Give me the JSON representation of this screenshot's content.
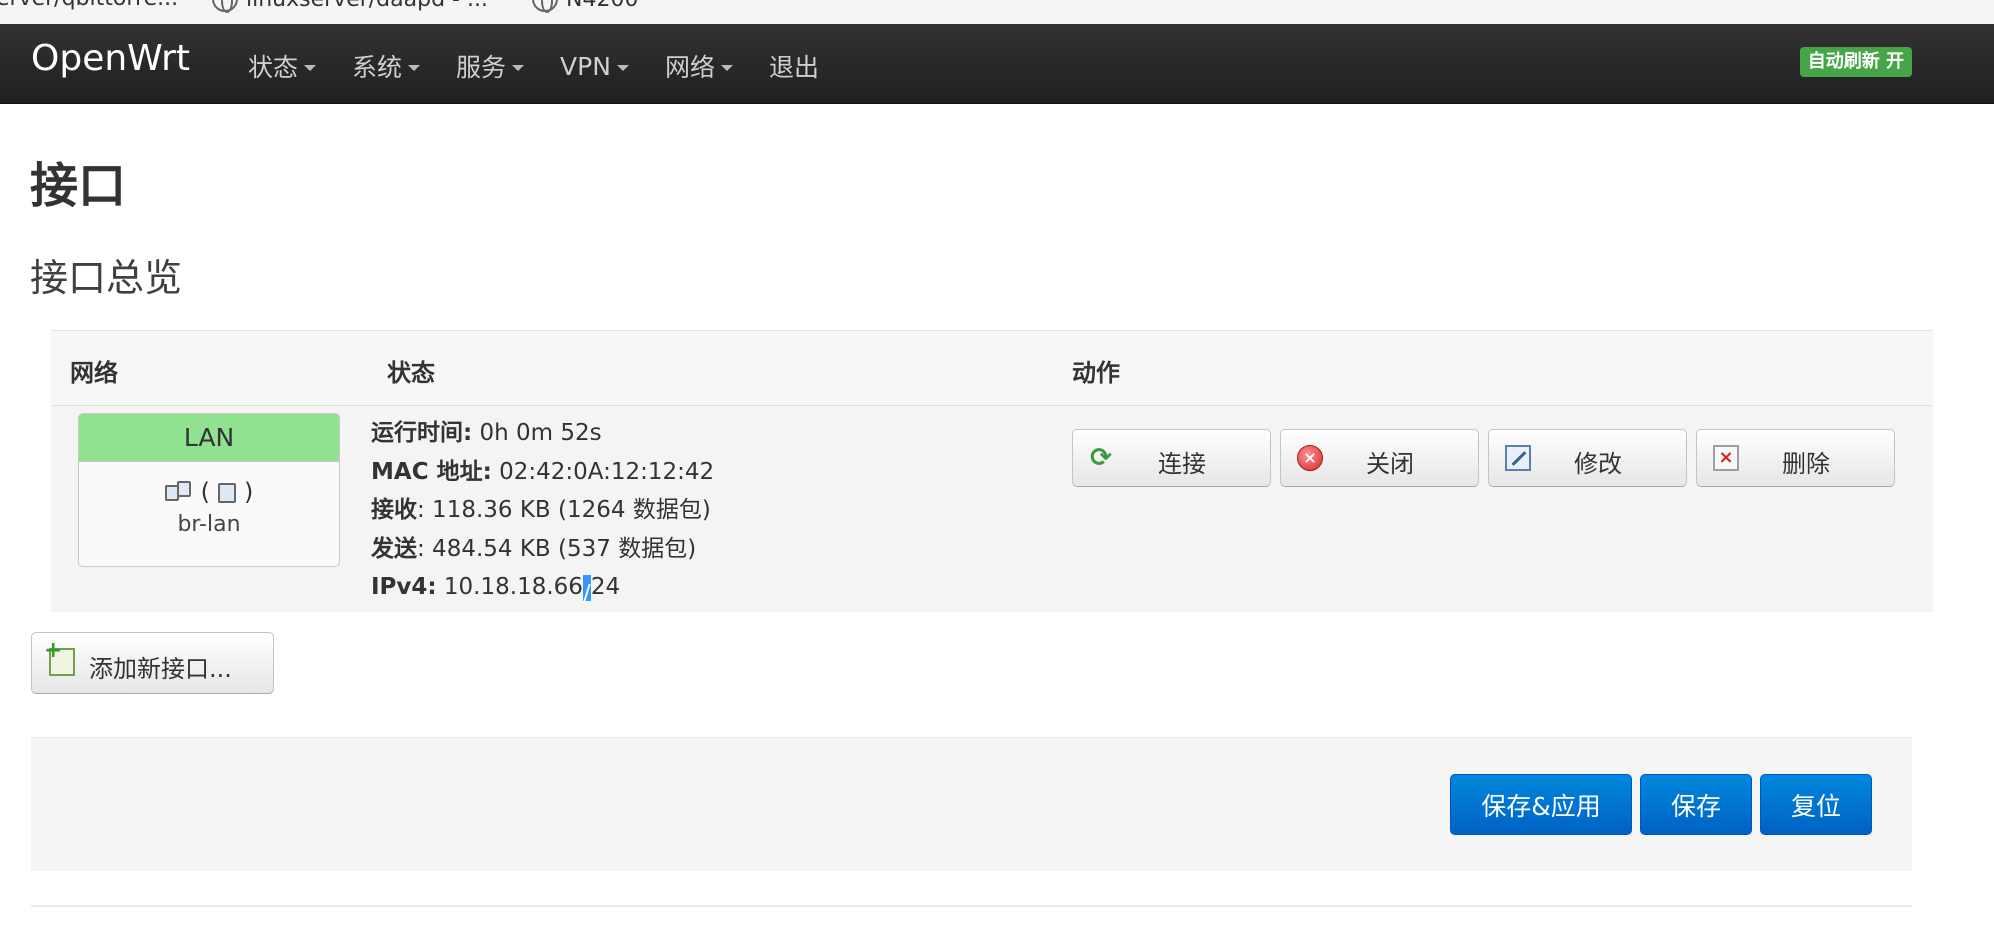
{
  "browser": {
    "bookmarks": [
      {
        "label": "erver/qbittorre..."
      },
      {
        "label": "linuxserver/daapd - ..."
      },
      {
        "label": "N4200"
      }
    ]
  },
  "navbar": {
    "brand": "OpenWrt",
    "menu": [
      {
        "label": "状态",
        "has_dropdown": true
      },
      {
        "label": "系统",
        "has_dropdown": true
      },
      {
        "label": "服务",
        "has_dropdown": true
      },
      {
        "label": "VPN",
        "has_dropdown": true
      },
      {
        "label": "网络",
        "has_dropdown": true
      },
      {
        "label": "退出",
        "has_dropdown": false
      }
    ],
    "autorefresh": "自动刷新 开",
    "autorefresh_color": "#46a546"
  },
  "page": {
    "title": "接口",
    "section_title": "接口总览"
  },
  "table": {
    "headers": {
      "network": "网络",
      "status": "状态",
      "actions": "动作"
    },
    "rows": [
      {
        "network": {
          "name": "LAN",
          "device_icons": "(   )",
          "device": "br-lan",
          "badge_color": "#90e290"
        },
        "status": {
          "uptime_label": "运行时间:",
          "uptime_value": " 0h 0m 52s",
          "mac_label": "MAC 地址:",
          "mac_value": " 02:42:0A:12:12:42",
          "rx_label": "接收",
          "rx_value": ": 118.36 KB (1264 数据包)",
          "tx_label": "发送",
          "tx_value": ": 484.54 KB (537 数据包)",
          "ipv4_label": "IPv4:",
          "ipv4_value_a": " 10.18.18.66",
          "ipv4_value_sel": "/",
          "ipv4_value_b": "24"
        },
        "actions": {
          "connect": "连接",
          "stop": "关闭",
          "edit": "修改",
          "delete": "删除"
        }
      }
    ]
  },
  "add_interface": "添加新接口...",
  "footer": {
    "save_apply": "保存&应用",
    "save": "保存",
    "reset": "复位",
    "primary_color": "#0074d9"
  }
}
